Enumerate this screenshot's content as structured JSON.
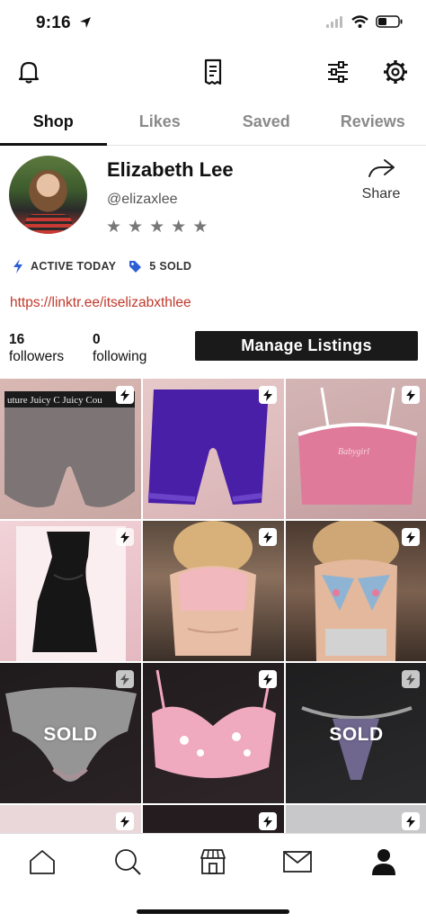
{
  "status_bar": {
    "time": "9:16"
  },
  "tabs": [
    {
      "label": "Shop",
      "active": true
    },
    {
      "label": "Likes",
      "active": false
    },
    {
      "label": "Saved",
      "active": false
    },
    {
      "label": "Reviews",
      "active": false
    }
  ],
  "profile": {
    "name": "Elizabeth Lee",
    "handle": "@elizaxlee",
    "rating_stars": 5,
    "share_label": "Share",
    "active_label": "ACTIVE TODAY",
    "sold_label": "5 SOLD",
    "link": "https://linktr.ee/itselizabxthlee",
    "followers_count": "16",
    "followers_label": "followers",
    "following_count": "0",
    "following_label": "following",
    "manage_button": "Manage Listings"
  },
  "listings": [
    {
      "item": "Juicy Couture grey shorts",
      "sold": false,
      "banner": "uture  Juicy C  Juicy Cou"
    },
    {
      "item": "purple lace bike shorts",
      "sold": false
    },
    {
      "item": "pink babygirl crop cami",
      "sold": false
    },
    {
      "item": "black satin slip dress",
      "sold": false
    },
    {
      "item": "pink bandeau top",
      "sold": false
    },
    {
      "item": "floral bikini set",
      "sold": false
    },
    {
      "item": "grey lace panties",
      "sold": true,
      "sold_label": "SOLD"
    },
    {
      "item": "pink floral lace bra",
      "sold": false
    },
    {
      "item": "lavender thong",
      "sold": true,
      "sold_label": "SOLD"
    },
    {
      "item": "partial listing",
      "sold": false
    },
    {
      "item": "partial listing",
      "sold": false
    },
    {
      "item": "partial listing",
      "sold": false
    }
  ],
  "icons": {
    "toolbar": [
      "bell-icon",
      "receipt-icon",
      "sliders-icon",
      "gear-icon"
    ],
    "nav": [
      "home-icon",
      "search-icon",
      "store-icon",
      "mail-icon",
      "profile-icon"
    ]
  },
  "colors": {
    "link": "#c0392b",
    "accent_blue": "#2d5fd3",
    "button": "#1a1a1a"
  }
}
